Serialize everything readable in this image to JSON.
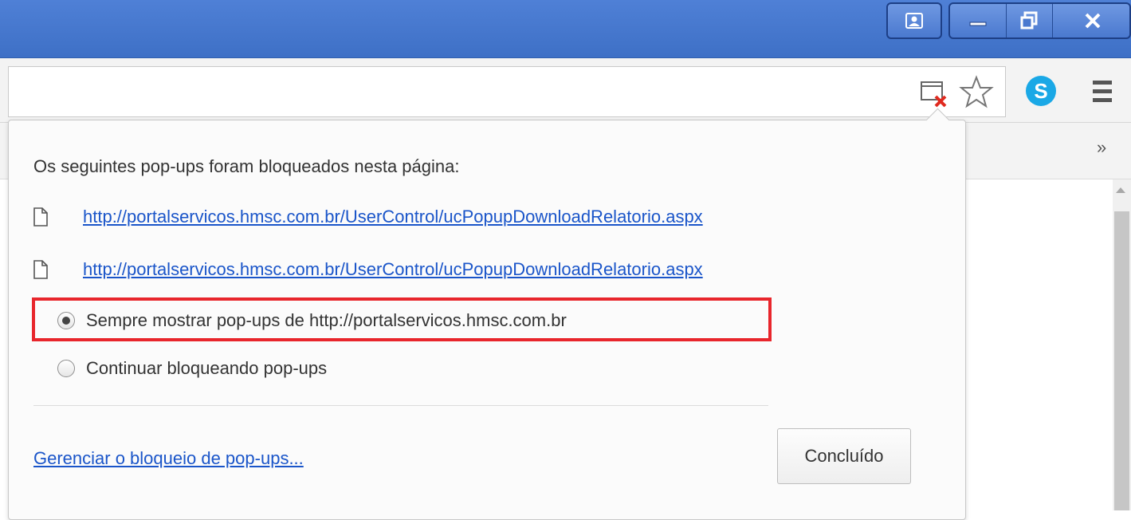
{
  "window": {
    "user_icon": "user-icon",
    "minimize_icon": "minimize-icon",
    "restore_icon": "restore-icon",
    "close_icon": "close-icon"
  },
  "toolbar": {
    "popup_blocked_icon": "popup-blocked-icon",
    "star_icon": "star-icon",
    "skype_icon": "skype-icon",
    "skype_letter": "S",
    "menu_icon": "menu-icon"
  },
  "bookmarks": {
    "more_label": "»"
  },
  "popup_bubble": {
    "title": "Os seguintes pop-ups foram bloqueados nesta página:",
    "blocked_popups": [
      "http://portalservicos.hmsc.com.br/UserControl/ucPopupDownloadRelatorio.aspx",
      "http://portalservicos.hmsc.com.br/UserControl/ucPopupDownloadRelatorio.aspx"
    ],
    "options": [
      {
        "label": "Sempre mostrar pop-ups de http://portalservicos.hmsc.com.br",
        "selected": true
      },
      {
        "label": "Continuar bloqueando pop-ups",
        "selected": false
      }
    ],
    "manage_link": "Gerenciar o bloqueio de pop-ups...",
    "done_button": "Concluído"
  },
  "colors": {
    "highlight": "#e8262c",
    "link": "#1a55c9",
    "titlebar": "#4a7bd0"
  }
}
